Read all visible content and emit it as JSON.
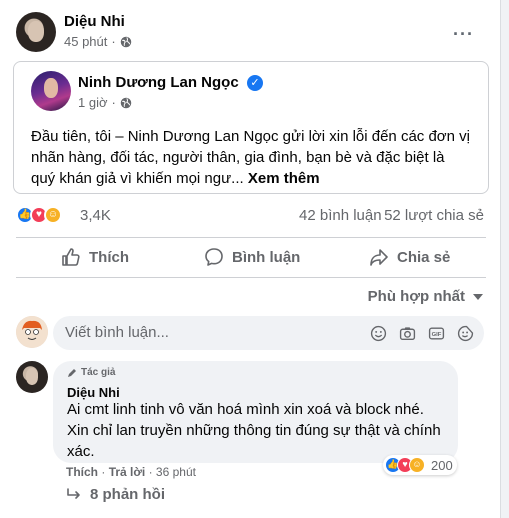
{
  "post": {
    "author": "Diệu Nhi",
    "time": "45 phút",
    "more": "···"
  },
  "shared": {
    "author": "Ninh Dương Lan Ngọc",
    "time": "1 giờ",
    "text": "Đầu tiên, tôi – Ninh Dương Lan Ngọc gửi lời xin lỗi đến các đơn vị nhãn hàng, đối tác, người thân, gia đình, bạn bè và đặc biệt là quý khán giả vì khiến mọi ngư...",
    "see_more": "Xem thêm"
  },
  "stats": {
    "reactions": "3,4K",
    "comments": "42 bình luận",
    "shares": "52 lượt chia sẻ"
  },
  "actions": {
    "like": "Thích",
    "comment": "Bình luận",
    "share": "Chia sẻ"
  },
  "sort": {
    "label": "Phù hợp nhất"
  },
  "composer": {
    "placeholder": "Viết bình luận..."
  },
  "comment": {
    "badge": "Tác giả",
    "author": "Diệu Nhi",
    "text": "Ai cmt linh tinh vô văn hoá mình xin xoá và block nhé. Xin chỉ lan truyền những thông tin đúng sự thật và chính xác.",
    "reaction_count": "200",
    "like": "Thích",
    "reply": "Trả lời",
    "time": "36 phút",
    "replies": "8 phản hồi"
  },
  "colors": {
    "accent": "#1877f2",
    "love": "#f33e58",
    "care": "#f7b125"
  }
}
